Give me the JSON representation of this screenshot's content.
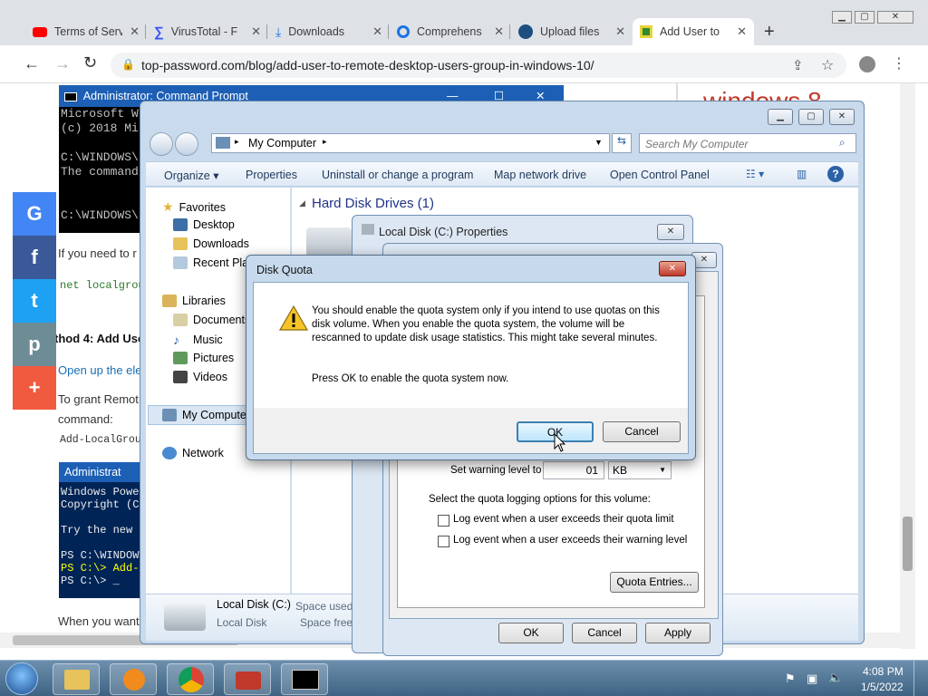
{
  "browser": {
    "tabs": [
      {
        "label": "Terms of Serv",
        "icon": "youtube-icon"
      },
      {
        "label": "VirusTotal - F",
        "icon": "virustotal-icon"
      },
      {
        "label": "Downloads",
        "icon": "download-icon"
      },
      {
        "label": "Comprehens",
        "icon": "location-icon"
      },
      {
        "label": "Upload files",
        "icon": "cloud-upload-icon"
      },
      {
        "label": "Add User to",
        "icon": "site-icon"
      }
    ],
    "url": "top-password.com/blog/add-user-to-remote-desktop-users-group-in-windows-10/"
  },
  "page": {
    "side_heading": "windows 8",
    "text1": "If you need to r",
    "code1": "net localgroup",
    "heading": "thod 4: Add Use",
    "text2": "Open up the ele",
    "text3": "To grant Remot",
    "text4": "command:",
    "code2": "Add-LocalGroup",
    "text5": "When you want",
    "social": [
      "G",
      "f",
      "t",
      "p",
      "+"
    ]
  },
  "cmd_window": {
    "title": "Administrator: Command Prompt",
    "lines": [
      "Microsoft W",
      "(c) 2018 Mi",
      "",
      "C:\\WINDOWS\\",
      "The command",
      "",
      "",
      "C:\\WINDOWS\\"
    ]
  },
  "ps_window": {
    "title": "Administrat",
    "lines": [
      "Windows Power",
      "Copyright (C)",
      "",
      "Try the new c",
      "",
      "PS C:\\WINDOWS",
      "PS C:\\> Add-L",
      "PS C:\\> _"
    ]
  },
  "explorer": {
    "breadcrumb": "My Computer",
    "search_placeholder": "Search My Computer",
    "commands": [
      "Organize",
      "Properties",
      "Uninstall or change a program",
      "Map network drive",
      "Open Control Panel"
    ],
    "nav": {
      "favorites": "Favorites",
      "desktop": "Desktop",
      "downloads": "Downloads",
      "recent": "Recent Plac",
      "libraries": "Libraries",
      "documents": "Documents",
      "music": "Music",
      "pictures": "Pictures",
      "videos": "Videos",
      "computer": "My Compute",
      "network": "Network"
    },
    "section": "Hard Disk Drives (1)",
    "details": {
      "name": "Local Disk (C:)",
      "type": "Local Disk",
      "space_used": "Space used:",
      "space_free": "Space free:"
    }
  },
  "properties": {
    "title": "Local Disk (C:) Properties",
    "warning_label": "Set warning level to",
    "warning_value": "01",
    "warning_unit": "KB",
    "logging_label": "Select the quota logging options for this volume:",
    "log_limit": "Log event when a user exceeds their quota limit",
    "log_warning": "Log event when a user exceeds their warning level",
    "quota_entries": "Quota Entries...",
    "ok": "OK",
    "cancel": "Cancel",
    "apply": "Apply"
  },
  "quota_dialog": {
    "title": "Disk Quota",
    "message": "You should enable the quota system only if you intend to use quotas on this disk volume.  When you enable the quota system, the volume will be rescanned to update disk usage statistics. This might take several minutes.",
    "prompt": "Press OK to enable the quota system now.",
    "ok": "OK",
    "cancel": "Cancel"
  },
  "taskbar": {
    "time": "4:08 PM",
    "date": "1/5/2022"
  }
}
